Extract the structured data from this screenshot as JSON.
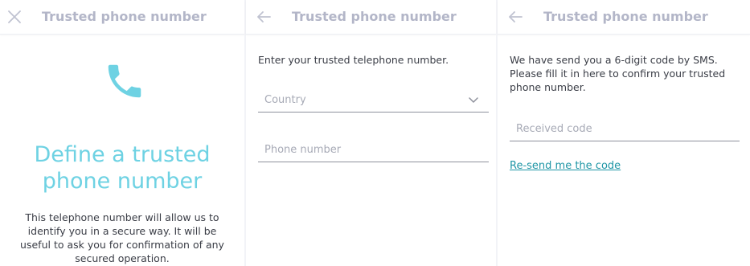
{
  "colors": {
    "accent": "#6ed2e3",
    "link": "#1f96a6",
    "header_text": "#b3b6c8",
    "body_text": "#3a3d46",
    "placeholder": "#a7aab6"
  },
  "screen1": {
    "header": {
      "icon": "close-icon",
      "title": "Trusted phone number"
    },
    "icon": "phone-icon",
    "title_line1": "Define a trusted",
    "title_line2": "phone number",
    "description": "This telephone number will allow us to identify you in a secure way. It will be useful to ask you for confirmation of any secured operation."
  },
  "screen2": {
    "header": {
      "icon": "arrow-left-icon",
      "title": "Trusted phone number"
    },
    "instruction": "Enter your trusted telephone number.",
    "country_placeholder": "Country",
    "phone_placeholder": "Phone number"
  },
  "screen3": {
    "header": {
      "icon": "arrow-left-icon",
      "title": "Trusted phone number"
    },
    "instruction": "We have send you a 6-digit code by SMS. Please fill it in here to confirm your trusted phone number.",
    "code_placeholder": "Received code",
    "resend_link": "Re-send me the code"
  }
}
